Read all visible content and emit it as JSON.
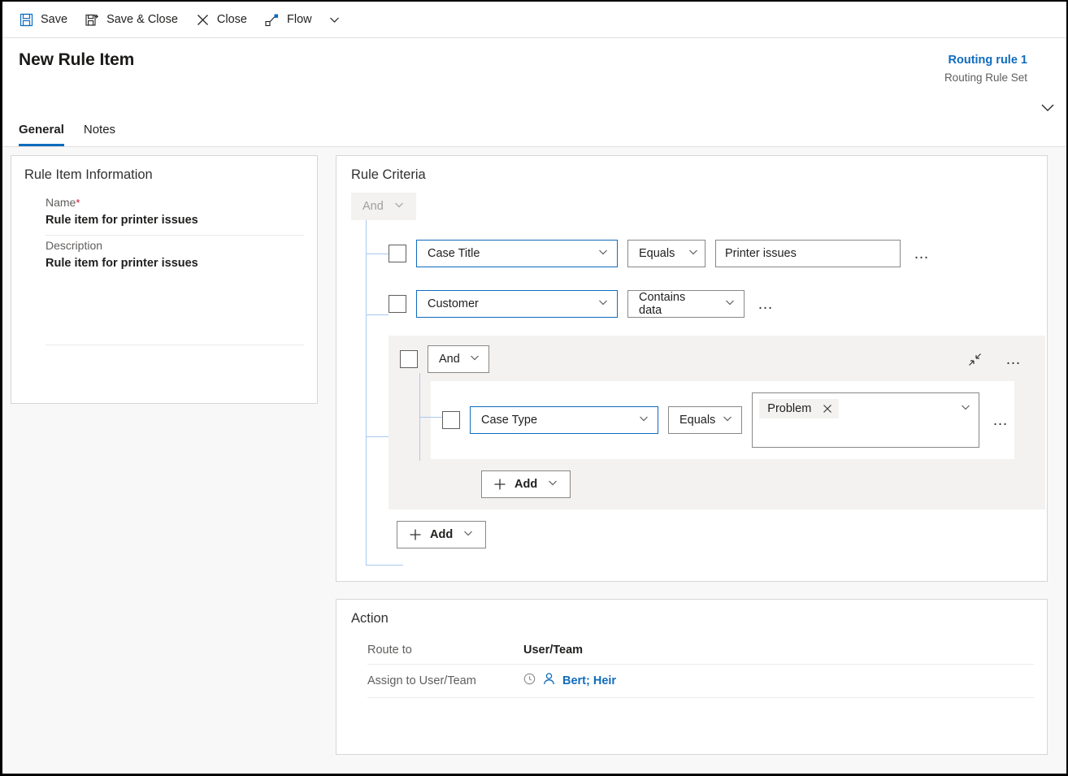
{
  "commandbar": {
    "items": [
      {
        "label": "Save",
        "icon": "save-icon"
      },
      {
        "label": "Save & Close",
        "icon": "save-and-close-icon"
      },
      {
        "label": "Close",
        "icon": "close-icon"
      },
      {
        "label": "Flow",
        "icon": "flow-icon"
      }
    ],
    "overflow_caret": "chevron-down-icon"
  },
  "header": {
    "title": "New Rule Item",
    "right_value": "Routing rule 1",
    "right_label": "Routing Rule Set",
    "collapse_icon": "chevron-down-icon",
    "tabs": [
      {
        "label": "General",
        "active": true
      },
      {
        "label": "Notes",
        "active": false
      }
    ]
  },
  "rule_item_information": {
    "title": "Rule Item Information",
    "name_label": "Name",
    "name_required": "*",
    "name_value": "Rule item for printer issues",
    "description_label": "Description",
    "description_value": "Rule item for printer issues"
  },
  "rule_criteria": {
    "title": "Rule Criteria",
    "root_operator": "And",
    "rows": [
      {
        "attribute": "Case Title",
        "operator": "Equals",
        "value": "Printer issues",
        "more": "…"
      },
      {
        "attribute": "Customer",
        "operator": "Contains data",
        "more": "…"
      }
    ],
    "group": {
      "operator": "And",
      "collapse_icon": "collapse-icon",
      "more": "…",
      "rows": [
        {
          "attribute": "Case Type",
          "operator": "Equals",
          "chip": "Problem",
          "chip_remove": "close-icon",
          "more": "…"
        }
      ],
      "add_label": "Add"
    },
    "add_label": "Add"
  },
  "action": {
    "title": "Action",
    "rows": [
      {
        "label": "Route to",
        "value": "User/Team"
      }
    ],
    "assign_label": "Assign to User/Team",
    "assign_value": "Bert; Heir",
    "assign_recent_icon": "recent-icon",
    "assign_person_icon": "person-icon"
  },
  "colors": {
    "accent": "#0f6cbd",
    "tree_line": "#a9c9ee",
    "required": "#c8102e",
    "panel_bg": "#f3f2f1"
  }
}
